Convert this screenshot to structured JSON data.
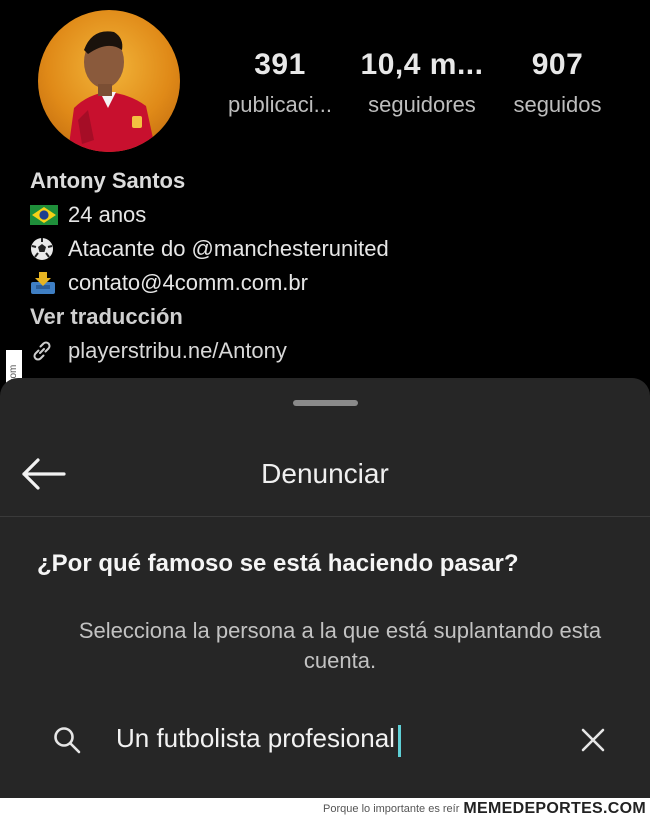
{
  "profile": {
    "stats": [
      {
        "value": "391",
        "label": "publicaci..."
      },
      {
        "value": "10,4 m...",
        "label": "seguidores"
      },
      {
        "value": "907",
        "label": "seguidos"
      }
    ],
    "name": "Antony Santos",
    "bio_lines": [
      {
        "icon": "brazil-flag-icon",
        "text": "24 anos"
      },
      {
        "icon": "soccer-ball-icon",
        "text": "Atacante do @manchesterunited"
      },
      {
        "icon": "inbox-tray-icon",
        "text": "contato@4comm.com.br"
      }
    ],
    "translate_label": "Ver traducción",
    "link": {
      "icon": "link-icon",
      "text": "playerstribu.ne/Antony"
    }
  },
  "sheet": {
    "title": "Denunciar",
    "question": "¿Por qué famoso se está haciendo pasar?",
    "subtitle": "Selecciona la persona a la que está suplantando esta cuenta.",
    "search": {
      "value": "Un futbolista profesional",
      "icon": "search-icon",
      "clear_icon": "close-icon"
    }
  },
  "watermark": {
    "vertical": "Memedeportes.com",
    "footer_tagline": "Porque lo importante es reír",
    "footer_brand": "MEMEDEPORTES.COM"
  },
  "colors": {
    "background": "#000000",
    "sheet": "#262626",
    "cursor": "#5fd0d6"
  }
}
